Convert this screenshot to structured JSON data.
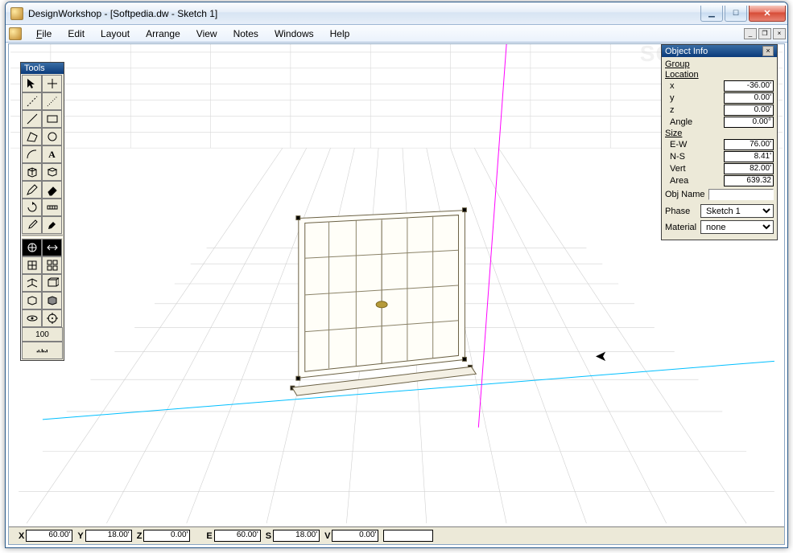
{
  "window": {
    "title": "DesignWorkshop - [Softpedia.dw - Sketch 1]"
  },
  "menu": {
    "file": "File",
    "edit": "Edit",
    "layout": "Layout",
    "arrange": "Arrange",
    "view": "View",
    "notes": "Notes",
    "windows": "Windows",
    "help": "Help"
  },
  "tools": {
    "title": "Tools",
    "opacity": "100"
  },
  "object_info": {
    "title": "Object Info",
    "group": "Group",
    "location": "Location",
    "x_label": "x",
    "x": "-36.00'",
    "y_label": "y",
    "y": "0.00'",
    "z_label": "z",
    "z": "0.00'",
    "angle_label": "Angle",
    "angle": "0.00°",
    "size": "Size",
    "ew_label": "E-W",
    "ew": "76.00'",
    "ns_label": "N-S",
    "ns": "8.41'",
    "vert_label": "Vert",
    "vert": "82.00'",
    "area_label": "Area",
    "area": "639.32",
    "objname": "Obj Name",
    "phase_label": "Phase",
    "phase": "Sketch 1",
    "material_label": "Material",
    "material": "none"
  },
  "status": {
    "x_l": "X",
    "x": "60.00'",
    "y_l": "Y",
    "y": "18.00'",
    "z_l": "Z",
    "z": "0.00'",
    "e_l": "E",
    "e": "60.00'",
    "s_l": "S",
    "s": "18.00'",
    "v_l": "V",
    "v": "0.00'"
  },
  "watermark": "SOFTPEDIA"
}
